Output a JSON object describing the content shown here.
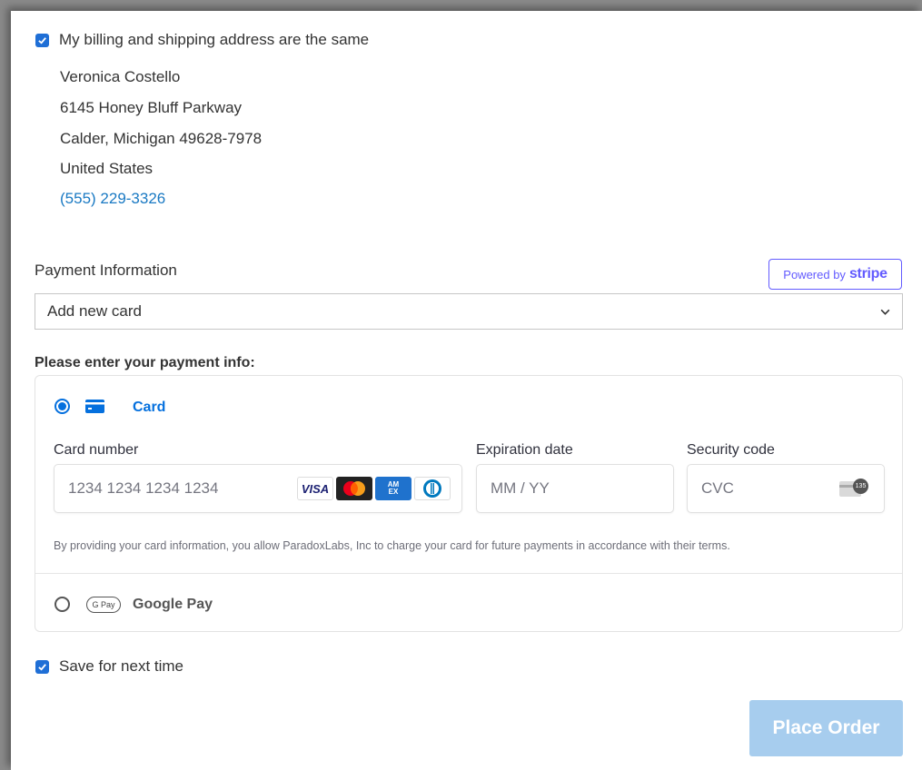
{
  "billing": {
    "same_address_label": "My billing and shipping address are the same",
    "same_address_checked": true,
    "address": {
      "name": "Veronica Costello",
      "street": "6145 Honey Bluff Parkway",
      "city_line": "Calder, Michigan 49628-7978",
      "country": "United States",
      "phone": "(555) 229-3326"
    }
  },
  "payment": {
    "title": "Payment Information",
    "powered_prefix": "Powered by",
    "powered_brand": "stripe",
    "card_select_value": "Add new card",
    "heading": "Please enter your payment info:",
    "methods": {
      "card": {
        "label": "Card",
        "selected": true,
        "card_number_label": "Card number",
        "card_number_placeholder": "1234 1234 1234 1234",
        "brands": [
          "VISA",
          "mastercard",
          "amex",
          "diners"
        ],
        "brand_visa_text": "VISA",
        "brand_amex_text": "AM EX",
        "expiration_label": "Expiration date",
        "expiration_placeholder": "MM / YY",
        "security_label": "Security code",
        "security_placeholder": "CVC",
        "cvc_badge": "135",
        "terms": "By providing your card information, you allow ParadoxLabs, Inc to charge your card for future payments in accordance with their terms."
      },
      "google_pay": {
        "label": "Google Pay",
        "badge": "G Pay",
        "selected": false
      }
    },
    "save_label": "Save for next time",
    "save_checked": true
  },
  "actions": {
    "place_order": "Place Order"
  },
  "colors": {
    "accent": "#1f6fd6",
    "stripe": "#635bff",
    "link": "#1979c3",
    "place_order_disabled": "#a7cdee"
  }
}
